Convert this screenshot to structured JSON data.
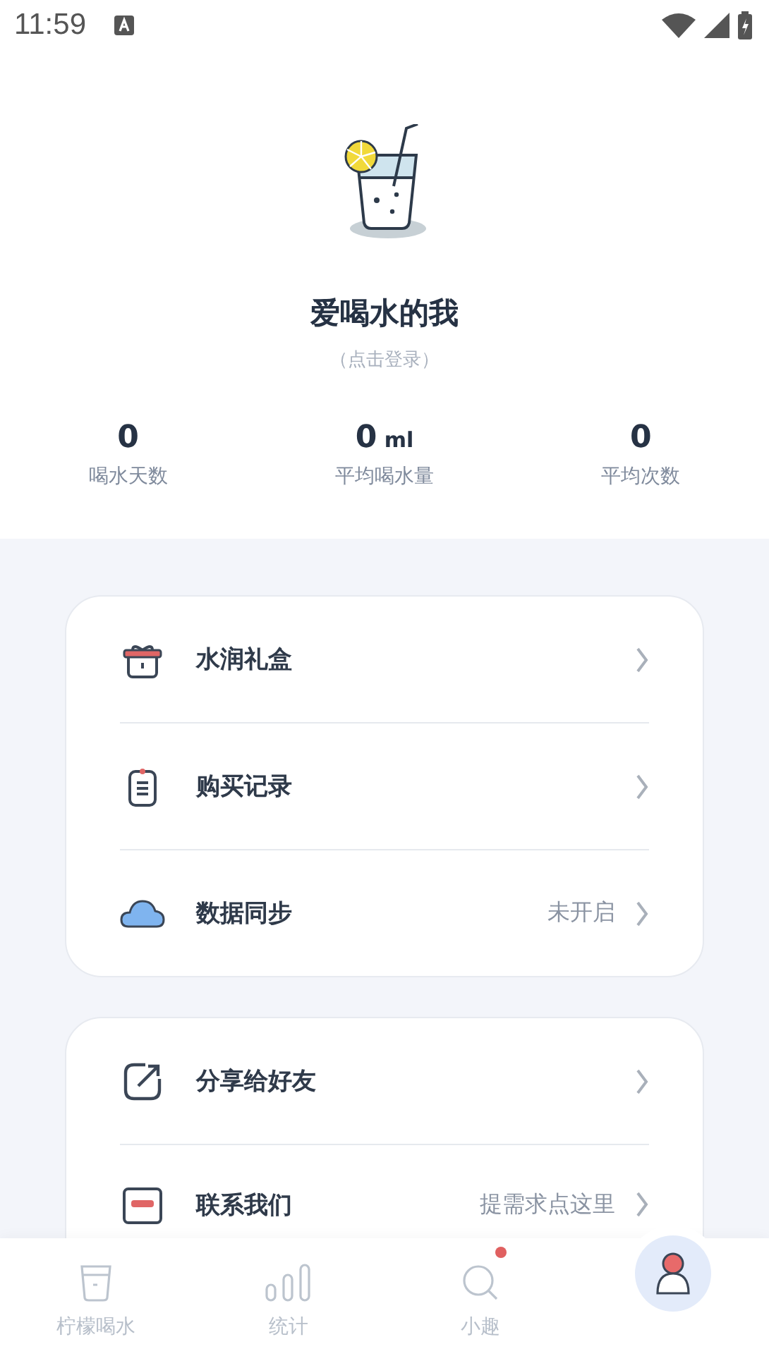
{
  "status_bar": {
    "time": "11:59"
  },
  "profile": {
    "name": "爱喝水的我",
    "login_hint": "（点击登录）"
  },
  "stats": [
    {
      "value": "0",
      "label": "喝水天数"
    },
    {
      "value": "0",
      "unit": "ml",
      "label": "平均喝水量"
    },
    {
      "value": "0",
      "label": "平均次数"
    }
  ],
  "menu_groups": [
    {
      "items": [
        {
          "kind": "gift",
          "label": "水润礼盒"
        },
        {
          "kind": "clipboard",
          "label": "购买记录"
        },
        {
          "kind": "cloud",
          "label": "数据同步",
          "status": "未开启"
        }
      ]
    },
    {
      "items": [
        {
          "kind": "share",
          "label": "分享给好友"
        },
        {
          "kind": "contact",
          "label": "联系我们",
          "status": "提需求点这里"
        }
      ]
    }
  ],
  "tabs": [
    {
      "kind": "glass",
      "label": "柠檬喝水",
      "selected": false,
      "badge": false
    },
    {
      "kind": "stats",
      "label": "统计",
      "selected": false,
      "badge": false
    },
    {
      "kind": "search",
      "label": "小趣",
      "selected": false,
      "badge": true
    },
    {
      "kind": "profile",
      "selected": true,
      "badge": false
    }
  ]
}
